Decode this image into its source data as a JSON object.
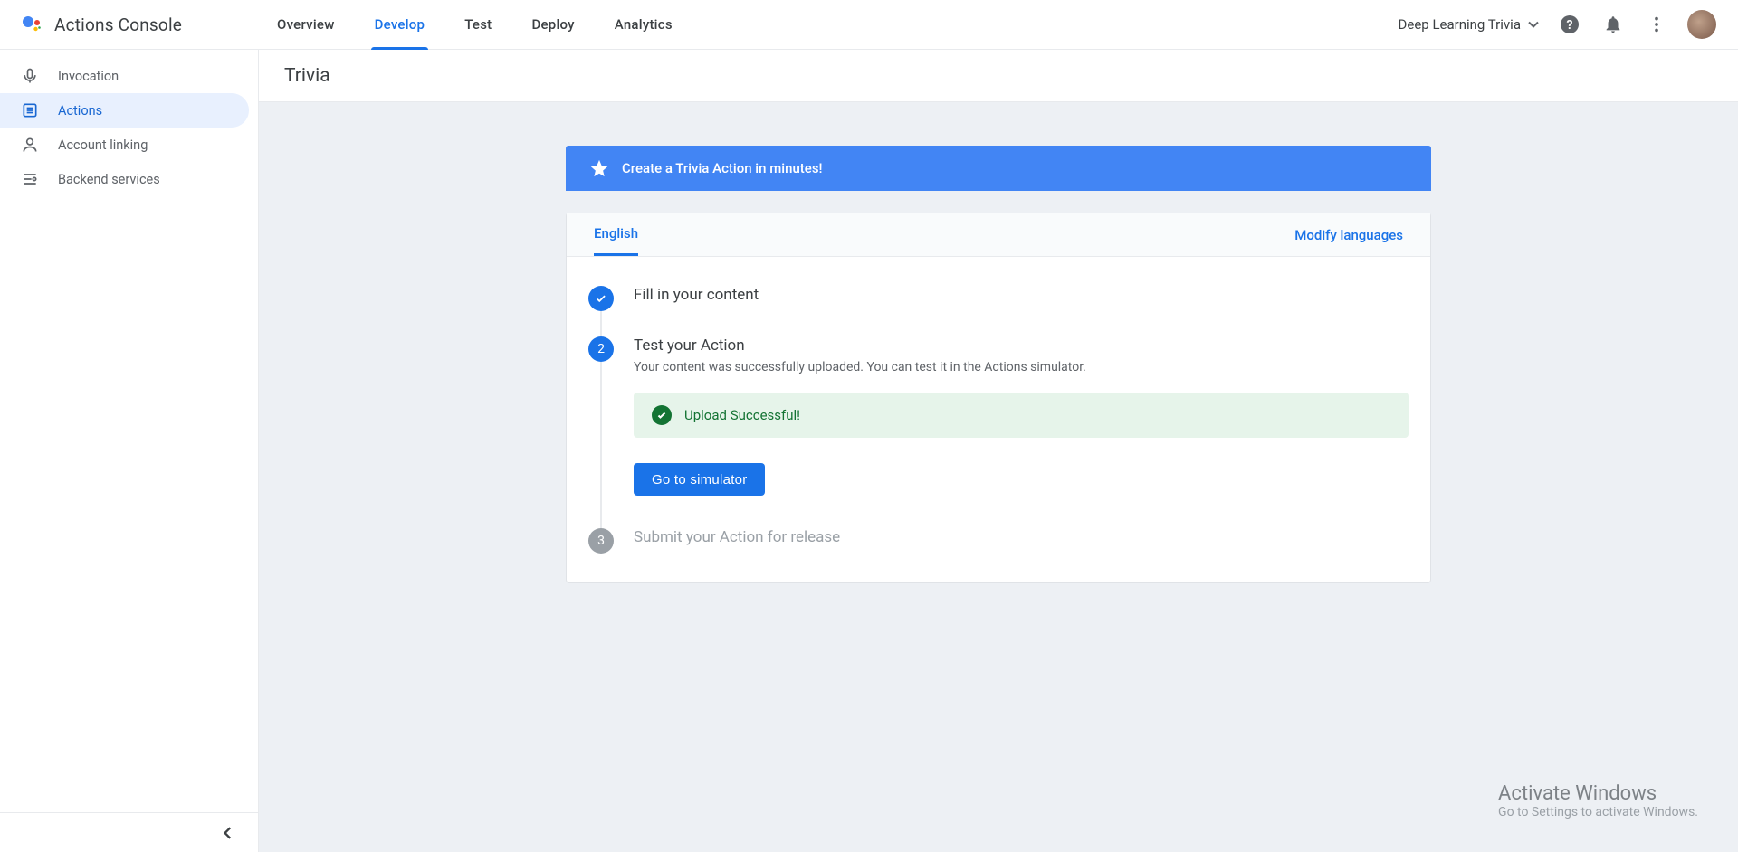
{
  "header": {
    "app_title": "Actions Console",
    "tabs": {
      "overview": "Overview",
      "develop": "Develop",
      "test": "Test",
      "deploy": "Deploy",
      "analytics": "Analytics"
    },
    "project_name": "Deep Learning Trivia"
  },
  "sidebar": {
    "items": {
      "invocation": "Invocation",
      "actions": "Actions",
      "account_linking": "Account linking",
      "backend_services": "Backend services"
    }
  },
  "page": {
    "title": "Trivia",
    "banner": "Create a Trivia Action in minutes!",
    "lang_tab": "English",
    "modify_link": "Modify languages",
    "step1_title": "Fill in your content",
    "step2_number": "2",
    "step2_title": "Test your Action",
    "step2_sub": "Your content was successfully uploaded. You can test it in the Actions simulator.",
    "success_msg": "Upload Successful!",
    "simulator_btn": "Go to simulator",
    "step3_number": "3",
    "step3_title": "Submit your Action for release"
  },
  "watermark": {
    "line1": "Activate Windows",
    "line2": "Go to Settings to activate Windows."
  }
}
